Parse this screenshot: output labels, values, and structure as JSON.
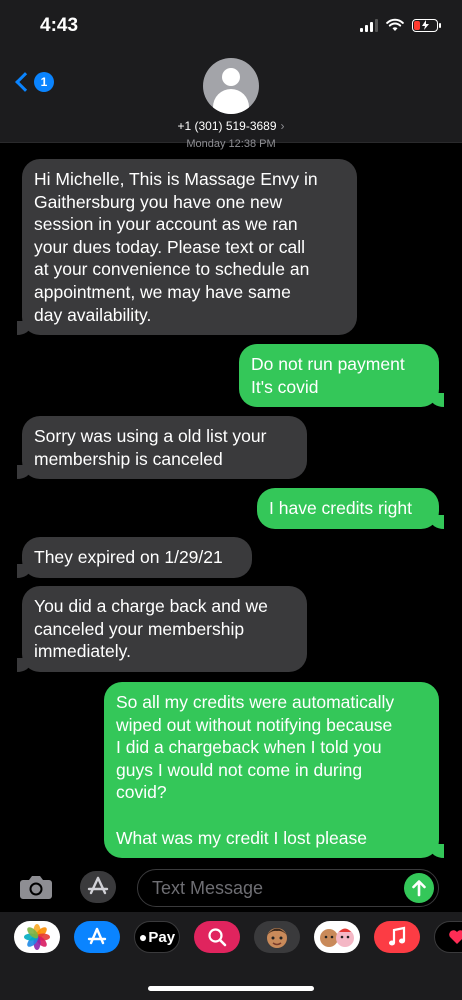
{
  "status": {
    "time": "4:43"
  },
  "header": {
    "back_badge": "1",
    "contact": "+1 (301) 519-3689",
    "timestamp_peek": "Monday 12:38 PM"
  },
  "messages": [
    {
      "dir": "in",
      "text": "Hi Michelle, This is Massage Envy in\nGaithersburg you have one new\nsession in your account as we ran\nyour dues today. Please text or call\nat your convenience to schedule an\nappointment, we may have same\nday availability."
    },
    {
      "dir": "out",
      "text": "Do not run payment\nIt's covid"
    },
    {
      "dir": "in",
      "text": "Sorry was using a old list your\nmembership is canceled"
    },
    {
      "dir": "out",
      "text": "I have credits right"
    },
    {
      "dir": "in",
      "text": "They expired on 1/29/21"
    },
    {
      "dir": "in",
      "text": "You did a charge back and we\ncanceled your membership\nimmediately."
    },
    {
      "dir": "out",
      "text": "So all my credits were automatically\nwiped out without notifying because\nI did a chargeback when I told you\nguys I would not come in during\ncovid?\n\nWhat was my credit I lost please"
    }
  ],
  "input": {
    "placeholder": "Text Message"
  },
  "apps": [
    {
      "name": "photos-app-icon",
      "label": "",
      "bg": "#ffffff"
    },
    {
      "name": "app-store-icon",
      "label": "",
      "bg": "#0a84ff"
    },
    {
      "name": "apple-pay-icon",
      "label": "Pay",
      "bg": "#000000"
    },
    {
      "name": "images-search-icon",
      "label": "",
      "bg": "#e0245e"
    },
    {
      "name": "memoji-icon",
      "label": "",
      "bg": "#3a3a3c"
    },
    {
      "name": "memoji-stickers-icon",
      "label": "",
      "bg": "#ffffff"
    },
    {
      "name": "music-app-icon",
      "label": "",
      "bg": "#fc3c44"
    },
    {
      "name": "digital-touch-icon",
      "label": "",
      "bg": "#000000"
    }
  ],
  "colors": {
    "incoming": "#3a3a3c",
    "outgoing": "#34c759",
    "accent": "#0a84ff"
  }
}
